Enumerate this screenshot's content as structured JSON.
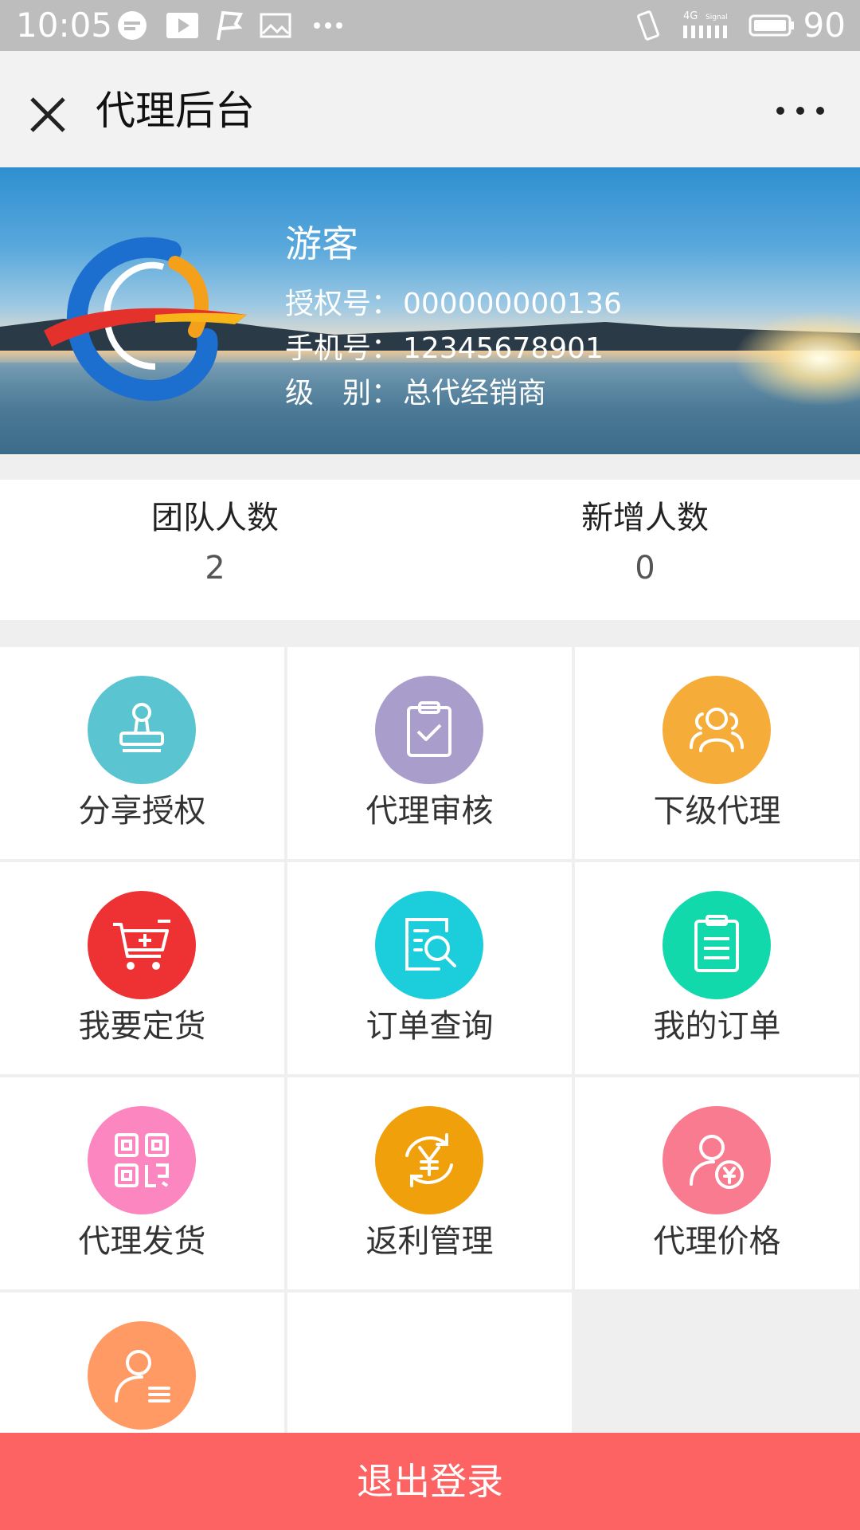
{
  "status_bar": {
    "time": "10:05",
    "battery": "90",
    "network": "4G",
    "signal_label": "Signal",
    "icons": [
      "chat-bubble-icon",
      "play-icon",
      "flag-icon",
      "image-icon",
      "more-dots-icon",
      "vibrate-icon",
      "signal-icon",
      "battery-icon"
    ]
  },
  "nav": {
    "title": "代理后台",
    "close_icon": "close-icon",
    "more_icon": "more-icon"
  },
  "profile": {
    "name": "游客",
    "auth_label": "授权号：",
    "auth_value": "000000000136",
    "phone_label": "手机号：",
    "phone_value": "12345678901",
    "level_label": "级　别：",
    "level_value": "总代经销商"
  },
  "stats": [
    {
      "label": "团队人数",
      "value": "2"
    },
    {
      "label": "新增人数",
      "value": "0"
    }
  ],
  "menu": [
    {
      "label": "分享授权",
      "icon": "stamp-icon",
      "color": "#5bc4d1"
    },
    {
      "label": "代理审核",
      "icon": "clipboard-check-icon",
      "color": "#a99dcb"
    },
    {
      "label": "下级代理",
      "icon": "group-icon",
      "color": "#f5ac38"
    },
    {
      "label": "我要定货",
      "icon": "cart-icon",
      "color": "#ee3234"
    },
    {
      "label": "订单查询",
      "icon": "document-search-icon",
      "color": "#1ccddc"
    },
    {
      "label": "我的订单",
      "icon": "clipboard-list-icon",
      "color": "#12d9ab"
    },
    {
      "label": "代理发货",
      "icon": "qrcode-icon",
      "color": "#fb86c0"
    },
    {
      "label": "返利管理",
      "icon": "yen-refresh-icon",
      "color": "#f0a00b"
    },
    {
      "label": "代理价格",
      "icon": "user-yen-icon",
      "color": "#f97b8f"
    },
    {
      "label": "",
      "icon": "user-list-icon",
      "color": "#ff9a64"
    }
  ],
  "logout_label": "退出登录"
}
